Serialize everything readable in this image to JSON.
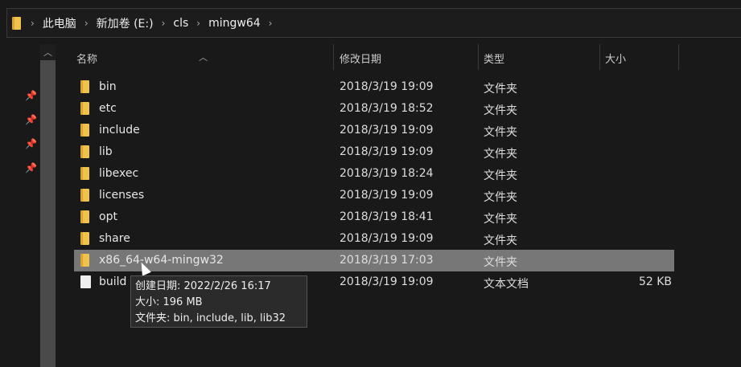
{
  "address": {
    "segments": [
      "此电脑",
      "新加卷 (E:)",
      "cls",
      "mingw64"
    ]
  },
  "columns": [
    "名称",
    "修改日期",
    "类型",
    "大小"
  ],
  "files": [
    {
      "name": "bin",
      "date": "2018/3/19 19:09",
      "type": "文件夹",
      "size": "",
      "kind": "folder"
    },
    {
      "name": "etc",
      "date": "2018/3/19 18:52",
      "type": "文件夹",
      "size": "",
      "kind": "folder"
    },
    {
      "name": "include",
      "date": "2018/3/19 19:09",
      "type": "文件夹",
      "size": "",
      "kind": "folder"
    },
    {
      "name": "lib",
      "date": "2018/3/19 19:09",
      "type": "文件夹",
      "size": "",
      "kind": "folder"
    },
    {
      "name": "libexec",
      "date": "2018/3/19 18:24",
      "type": "文件夹",
      "size": "",
      "kind": "folder"
    },
    {
      "name": "licenses",
      "date": "2018/3/19 19:09",
      "type": "文件夹",
      "size": "",
      "kind": "folder"
    },
    {
      "name": "opt",
      "date": "2018/3/19 18:41",
      "type": "文件夹",
      "size": "",
      "kind": "folder"
    },
    {
      "name": "share",
      "date": "2018/3/19 19:09",
      "type": "文件夹",
      "size": "",
      "kind": "folder"
    },
    {
      "name": "x86_64-w64-mingw32",
      "date": "2018/3/19 17:03",
      "type": "文件夹",
      "size": "",
      "kind": "folder",
      "selected": true
    },
    {
      "name": "build",
      "date": "2018/3/19 19:09",
      "type": "文本文档",
      "size": "52 KB",
      "kind": "file"
    }
  ],
  "tooltip": {
    "line1": "创建日期: 2022/2/26 16:17",
    "line2": "大小: 196 MB",
    "line3": "文件夹: bin, include, lib, lib32"
  }
}
